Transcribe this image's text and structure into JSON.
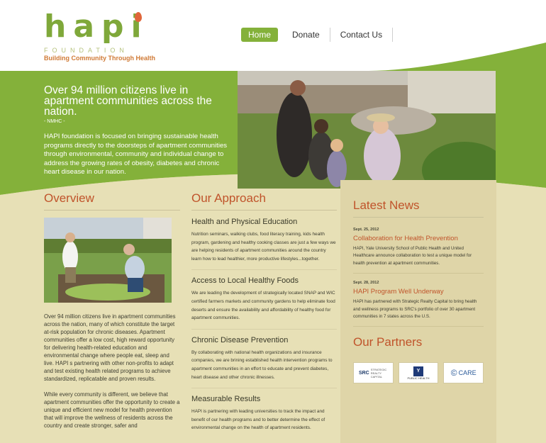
{
  "logo": {
    "word": "hapi",
    "foundation": "FOUNDATION",
    "tagline": "Building Community Through Health"
  },
  "nav": {
    "items": [
      "Home",
      "Donate",
      "Contact Us"
    ],
    "active": "Home"
  },
  "hero": {
    "title": "Over 94 million citizens live in apartment communities across the nation.",
    "source": "- NMHC -",
    "body": "HAPI foundation is focused on bringing sustainable health programs directly to the doorsteps of apartment communities through environmental, community and individual change to address the growing rates of obesity, diabetes and chronic heart disease in our nation."
  },
  "overview": {
    "title": "Overview",
    "para1": "Over 94 million citizens live in apartment communities across the nation, many of which constitute the target at-risk population for chronic diseases. Apartment communities offer a low cost, high reward opportunity for delivering health-related education and environmental change where people eat, sleep and live. HAPI s partnering with other non-profits to adapt and test existing health related programs to achieve standardized, replicatable and proven results.",
    "para2": "While every community is different, we believe that apartment communities offer the opportunity to create a unique and efficient new model for health prevention that will improve the wellness of residents across the country and create stronger, safer and"
  },
  "approach": {
    "title": "Our Approach",
    "sections": [
      {
        "title": "Health and Physical Education",
        "body": "Nutrition seminars, walking clubs, food literacy training, kids health program, gardening and healthy cooking classes are just a few ways we are helping residents of apartment communities around the country learn how to lead healthier, more productive lifestyles...together."
      },
      {
        "title": "Access to Local Healthy Foods",
        "body": "We are leading the development of strategically located SNAP and WIC certified farmers markets and community gardens to help eliminate food deserts and ensure the availability and affordability of healthy food for apartment communities."
      },
      {
        "title": "Chronic Disease Prevention",
        "body": "By collaborating with national health organizations and insurance companies, we are brining established health intervention programs to apartment communities in an effort to educate and prevent diabetes, heart disease and other chronic illnesses."
      },
      {
        "title": "Measurable Results",
        "body": "HAPI is partnering with leading universities to track the impact and benefit of our health programs and to better determine the effect of environmental change on the health of apartment residents."
      }
    ]
  },
  "news": {
    "title": "Latest News",
    "items": [
      {
        "date": "Sept. 25, 2012",
        "title": "Collaboration for Health Prevention",
        "body": "HAPI, Yale University School of Public Health and United Healthcare announce collaboration to test a unique model for health prevention at apartment communities."
      },
      {
        "date": "Sept. 28, 2012",
        "title": "HAPI Program Well Underway",
        "body": "HAPI has partnered with Strategic Realty Capital to bring health and wellness programs to SRC's portfolio of over 30 apartment communities in 7 states across the U.S."
      }
    ]
  },
  "partners": {
    "title": "Our Partners",
    "logos": [
      {
        "mark": "SRC",
        "text": "STRATEGIC REALTY CAPITAL"
      },
      {
        "mark": "Y",
        "text": "PUBLIC HEALTH"
      },
      {
        "mark": "©",
        "text": "CARE"
      }
    ]
  },
  "colors": {
    "green": "#84b13a",
    "orange": "#c0542b",
    "cream": "#e7e0b6",
    "panel": "#dfd5a8"
  }
}
